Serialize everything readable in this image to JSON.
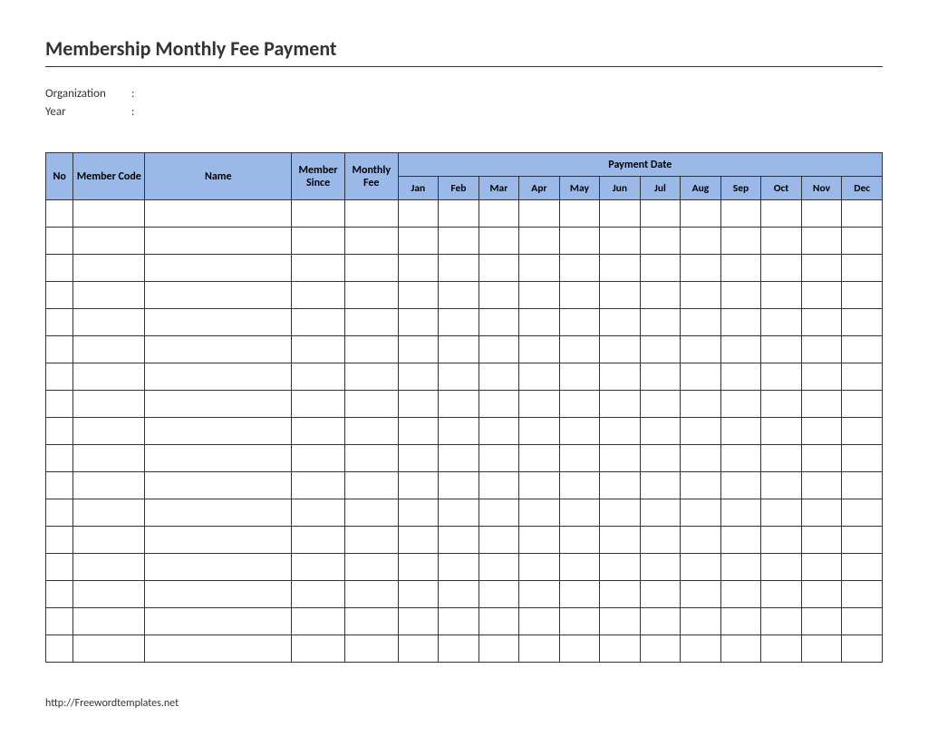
{
  "title": "Membership Monthly Fee Payment",
  "meta": {
    "organization_label": "Organization",
    "year_label": "Year",
    "colon": ":"
  },
  "headers": {
    "no": "No",
    "member_code": "Member Code",
    "name": "Name",
    "member_since": "Member Since",
    "monthly_fee": "Monthly Fee",
    "payment_date": "Payment Date"
  },
  "months": {
    "jan": "Jan",
    "feb": "Feb",
    "mar": "Mar",
    "apr": "Apr",
    "may": "May",
    "jun": "Jun",
    "jul": "Jul",
    "aug": "Aug",
    "sep": "Sep",
    "oct": "Oct",
    "nov": "Nov",
    "dec": "Dec"
  },
  "row_count": 17,
  "footer": "http://Freewordtemplates.net"
}
